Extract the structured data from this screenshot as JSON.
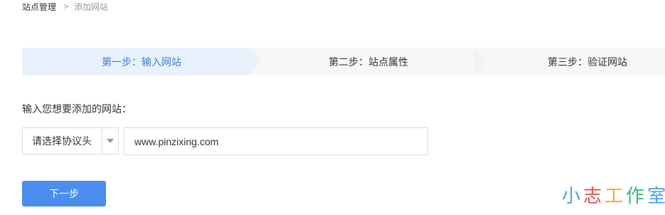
{
  "breadcrumb": {
    "root": "站点管理",
    "separator": ">",
    "current": "添加网站"
  },
  "steps": [
    {
      "label": "第一步：输入网站",
      "active": true
    },
    {
      "label": "第二步：站点属性",
      "active": false
    },
    {
      "label": "第三步：验证网站",
      "active": false
    }
  ],
  "form": {
    "prompt": "输入您想要添加的网站：",
    "protocol_select": {
      "selected": "请选择协议头",
      "icon": "chevron-down-icon"
    },
    "url_input": {
      "value": "www.pinzixing.com",
      "placeholder": ""
    },
    "next_label": "下一步"
  },
  "watermark": {
    "chars": [
      {
        "char": "小",
        "color": "#4aa3e0"
      },
      {
        "char": "志",
        "color": "#e8504a"
      },
      {
        "char": "工",
        "color": "#f2b02e"
      },
      {
        "char": "作",
        "color": "#3cb878"
      },
      {
        "char": "室",
        "color": "#4aa3e0"
      }
    ]
  },
  "colors": {
    "accent": "#4a8ef0",
    "active_step_text": "#3e7ed5",
    "active_step_bg": "#e8f1fc"
  }
}
